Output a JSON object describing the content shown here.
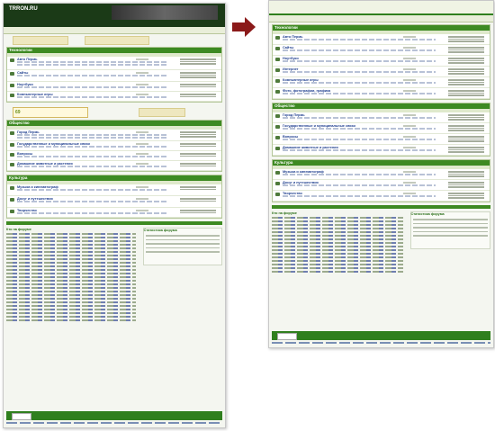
{
  "left": {
    "logo": "TRRON.RU",
    "sections": [
      {
        "title": "Технологии",
        "rows": [
          {
            "title": "Авто Пермь"
          },
          {
            "title": "Сайты"
          },
          {
            "title": "Ноутбуки"
          },
          {
            "title": "Компьютерные игры"
          }
        ]
      },
      {
        "title": "Общество",
        "rows": [
          {
            "title": "Город Пермь"
          },
          {
            "title": "Государственные и муниципальные связи"
          },
          {
            "title": "Вопросы"
          },
          {
            "title": "Домашние животные и растения"
          }
        ]
      },
      {
        "title": "Культура",
        "rows": [
          {
            "title": "Музыка и кинематограф"
          },
          {
            "title": "Досуг и путешествия"
          },
          {
            "title": "Творчество"
          }
        ]
      }
    ],
    "promo": "69",
    "who_title": "Кто на форуме",
    "stats_title": "Статистика форума"
  },
  "right": {
    "sections": [
      {
        "title": "Технологии",
        "rows": [
          {
            "title": "Авто Пермь"
          },
          {
            "title": "Сайты"
          },
          {
            "title": "Ноутбуки"
          },
          {
            "title": "Интернет"
          },
          {
            "title": "Компьютерные игры"
          },
          {
            "title": "Фото, фотографии, графика"
          }
        ]
      },
      {
        "title": "Общество",
        "rows": [
          {
            "title": "Город Пермь"
          },
          {
            "title": "Государственные и муниципальные связи"
          },
          {
            "title": "Вопросы"
          },
          {
            "title": "Домашние животные и растения"
          }
        ]
      },
      {
        "title": "Культура",
        "rows": [
          {
            "title": "Музыка и кинематограф"
          },
          {
            "title": "Досуг и путешествия"
          },
          {
            "title": "Творчество"
          }
        ]
      }
    ],
    "who_title": "Кто на форуме",
    "stats_title": "Статистика форума"
  },
  "colors": {
    "arrow": "#8b1a1a",
    "accent": "#3d8a22"
  },
  "icons": {
    "arrow": "right-arrow-icon"
  }
}
